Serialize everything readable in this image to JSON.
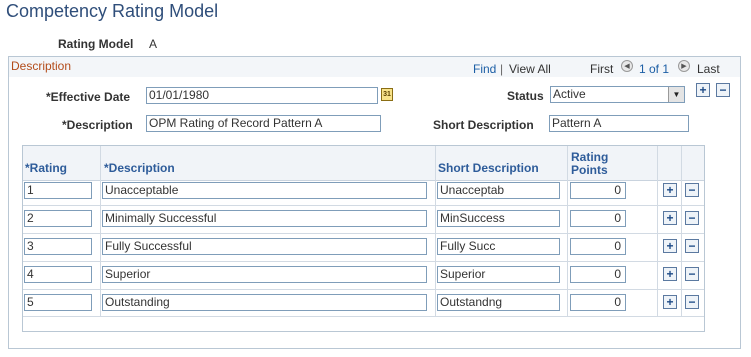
{
  "page": {
    "title": "Competency Rating Model"
  },
  "rating_model": {
    "label": "Rating Model",
    "value": "A"
  },
  "section": {
    "title": "Description",
    "nav": {
      "find": "Find",
      "sep": "|",
      "view_all": "View All",
      "first": "First",
      "range": "1 of 1",
      "last": "Last"
    }
  },
  "form": {
    "effective_date": {
      "label": "*Effective Date",
      "value": "01/01/1980"
    },
    "status": {
      "label": "Status",
      "value": "Active"
    },
    "description": {
      "label": "*Description",
      "value": "OPM Rating of Record Pattern A"
    },
    "short_description": {
      "label": "Short Description",
      "value": "Pattern A"
    }
  },
  "grid": {
    "headers": {
      "rating": "*Rating",
      "description": "*Description",
      "short_description": "Short Description",
      "rating_points_1": "Rating",
      "rating_points_2": "Points"
    },
    "rows": [
      {
        "rating": "1",
        "description": "Unacceptable",
        "short": "Unacceptab",
        "points": "0"
      },
      {
        "rating": "2",
        "description": "Minimally Successful",
        "short": "MinSuccess",
        "points": "0"
      },
      {
        "rating": "3",
        "description": "Fully Successful",
        "short": "Fully Succ",
        "points": "0"
      },
      {
        "rating": "4",
        "description": "Superior",
        "short": "Superior",
        "points": "0"
      },
      {
        "rating": "5",
        "description": "Outstanding",
        "short": "Outstandng",
        "points": "0"
      }
    ]
  },
  "icons": {
    "add": "+",
    "remove": "−",
    "calendar": "31"
  }
}
